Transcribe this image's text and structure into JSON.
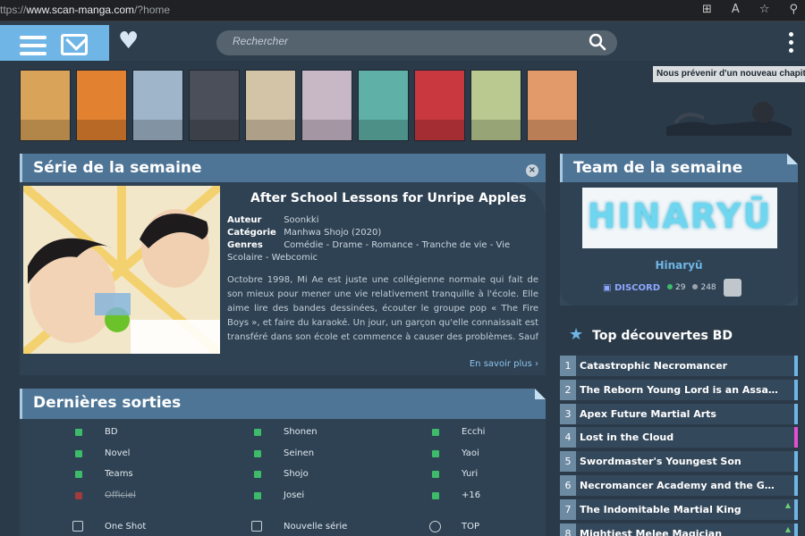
{
  "browser": {
    "url_prefix": "ttps://",
    "url_host": "www.scan-manga.com",
    "url_path": "/?home"
  },
  "header": {
    "search_placeholder": "Rechercher"
  },
  "notification": {
    "text": "Nous prévenir d'un nouveau chapitre"
  },
  "covers": [
    "#d9a35a",
    "#e2812f",
    "#9fb5c9",
    "#4a4f5a",
    "#d3c3a7",
    "#c8b8c6",
    "#5fb0a6",
    "#c9373f",
    "#b9c98f",
    "#e39a6b"
  ],
  "serie": {
    "section_title": "Série de la semaine",
    "title": "After School Lessons for Unripe Apples",
    "author_label": "Auteur",
    "author": "Soonkki",
    "category_label": "Catégorie",
    "category": "Manhwa Shojo (2020)",
    "genres_label": "Genres",
    "genres": "Comédie - Drame - Romance - Tranche de vie - Vie Scolaire - Webcomic",
    "description": "Octobre 1998, Mi Ae est juste une collégienne normale qui fait de son mieux pour mener une vie relativement tranquille à l'école. Elle aime lire des bandes dessinées, écouter le groupe pop « The Fire Boys », et faire du karaoké. Un jour, un garçon qu'elle connaissait est transféré dans son école et commence à causer des problèmes. Sauf que peu importe ce qu'elle fait, il semblerait qu'il n'apprécie pas les efforts de Mi Ae pour",
    "more": "En savoir plus ›"
  },
  "sorties": {
    "section_title": "Dernières sorties",
    "col1": [
      "BD",
      "Novel",
      "Teams",
      "Officiel"
    ],
    "col2": [
      "Shonen",
      "Seinen",
      "Shojo",
      "Josei"
    ],
    "col3": [
      "Ecchi",
      "Yaoi",
      "Yuri",
      "+16"
    ],
    "one_shot": "One Shot",
    "nouvelle_serie": "Nouvelle série",
    "top": "TOP"
  },
  "team": {
    "section_title": "Team de la semaine",
    "logo_text": "HINARYŪ",
    "name": "Hinaryū",
    "discord": "DISCORD",
    "online": "29",
    "members": "248"
  },
  "top": {
    "title": "Top découvertes BD",
    "items": [
      {
        "rank": "1",
        "title": "Catastrophic Necromancer",
        "color": "#6fb6e6"
      },
      {
        "rank": "2",
        "title": "The Reborn Young Lord is an Assassin",
        "color": "#6fb6e6"
      },
      {
        "rank": "3",
        "title": "Apex Future Martial Arts",
        "color": "#6fb6e6"
      },
      {
        "rank": "4",
        "title": "Lost in the Cloud",
        "color": "#e34fd0"
      },
      {
        "rank": "5",
        "title": "Swordmaster's Youngest Son",
        "color": "#6fb6e6"
      },
      {
        "rank": "6",
        "title": "Necromancer Academy and the Genius Summoner",
        "color": "#6fb6e6"
      },
      {
        "rank": "7",
        "title": "The Indomitable Martial King",
        "color": "#6fb6e6"
      },
      {
        "rank": "8",
        "title": "Mightiest Melee Magician",
        "color": "#6fb6e6"
      }
    ]
  }
}
